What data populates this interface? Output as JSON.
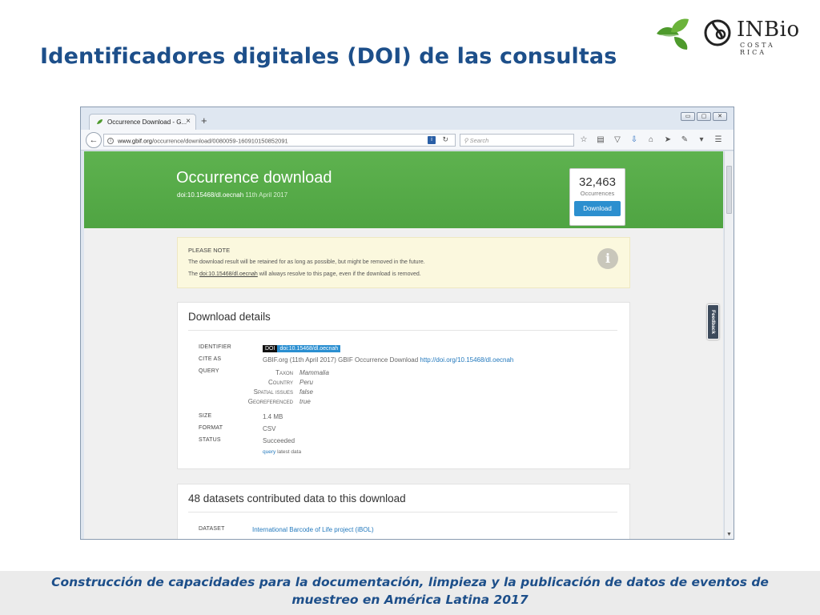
{
  "slide": {
    "title": "Identificadores digitales (DOI) de las consultas",
    "logo": {
      "name": "INBio",
      "subtitle": "COSTA RICA"
    },
    "footer": "Construcción de capacidades para la documentación, limpieza y la publicación de datos de eventos de muestreo en América Latina 2017"
  },
  "browser": {
    "tab_title": "Occurrence Download - G...",
    "tab_close": "×",
    "new_tab": "+",
    "url_host": "www.gbif.org",
    "url_path": "/occurrence/download/0080059-160910150852091",
    "search_placeholder": "Search",
    "window_buttons": [
      "▭",
      "▢",
      "✕"
    ]
  },
  "hero": {
    "title": "Occurrence download",
    "doi": "doi:10.15468/dl.oecnah",
    "date": "11th April 2017",
    "count": "32,463",
    "count_label": "Occurrences",
    "download_button": "Download"
  },
  "note": {
    "title": "PLEASE NOTE",
    "line1": "The download result will be retained for as long as possible, but might be removed in the future.",
    "line2_prefix": "The ",
    "line2_link": "doi:10.15468/dl.oecnah",
    "line2_suffix": " will always resolve to this page, even if the download is removed.",
    "icon": "i"
  },
  "details": {
    "title": "Download details",
    "identifier_label": "IDENTIFIER",
    "doi_tag": "DOI",
    "doi_value": "doi:10.15468/dl.oecnah",
    "cite_label": "CITE AS",
    "cite_text": "GBIF.org (11th April 2017) GBIF Occurrence Download ",
    "cite_link": "http://doi.org/10.15468/dl.oecnah",
    "query_label": "QUERY",
    "query": [
      {
        "key": "Taxon",
        "value": "Mammalia"
      },
      {
        "key": "Country",
        "value": "Peru"
      },
      {
        "key": "Spatial issues",
        "value": "false"
      },
      {
        "key": "Georeferenced",
        "value": "true"
      }
    ],
    "size_label": "SIZE",
    "size": "1.4 MB",
    "format_label": "FORMAT",
    "format": "CSV",
    "status_label": "STATUS",
    "status": "Succeeded",
    "query_link": "query",
    "latest_data": " latest data"
  },
  "datasets": {
    "title": "48 datasets contributed data to this download",
    "column_label": "DATASET",
    "first_dataset": "International Barcode of Life project (iBOL)"
  },
  "feedback": "Feedback",
  "colors": {
    "title_blue": "#1d4f8a",
    "hero_green": "#59ae4a",
    "link_blue": "#2379bd",
    "button_blue": "#2c8fcf",
    "note_bg": "#fbf8de"
  }
}
